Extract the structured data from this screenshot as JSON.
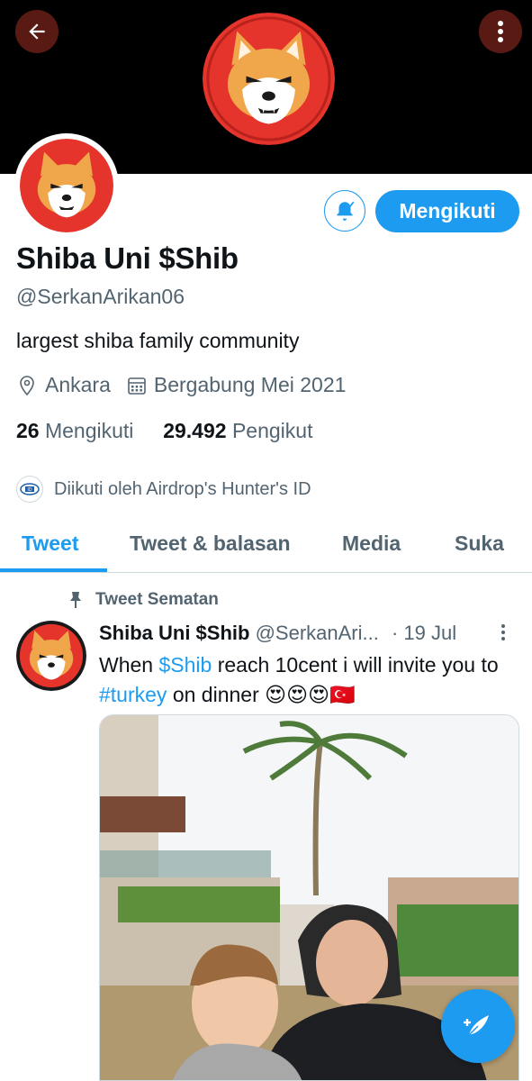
{
  "profile": {
    "name": "Shiba Uni $Shib",
    "handle": "@SerkanArikan06",
    "bio": "largest shiba family community",
    "location": "Ankara",
    "joined": "Bergabung Mei 2021",
    "following_count": "26",
    "following_label": "Mengikuti",
    "followers_count": "29.492",
    "followers_label": "Pengikut",
    "followed_by": "Diikuti oleh Airdrop's Hunter's ID"
  },
  "actions": {
    "follow_label": "Mengikuti"
  },
  "tabs": [
    {
      "label": "Tweet"
    },
    {
      "label": "Tweet & balasan"
    },
    {
      "label": "Media"
    },
    {
      "label": "Suka"
    }
  ],
  "pinned_tweet": {
    "pinned_label": "Tweet Sematan",
    "author_name": "Shiba Uni $Shib",
    "author_handle": "@SerkanAri...",
    "time": "· 19 Jul",
    "text_part1": "When ",
    "hashtag1": "$Shib",
    "text_part2": " reach 10cent i will invite you to ",
    "hashtag2": "#turkey",
    "text_part3": " on dinner ",
    "emoji": "😍😍😍🇹🇷"
  },
  "colors": {
    "accent": "#1d9bf0",
    "banner": "#000000",
    "header_button": "#5a1a14",
    "secondary_text": "#536471"
  },
  "icons": {
    "back": "arrow-left-icon",
    "more": "more-vertical-icon",
    "bell": "bell-notify-icon",
    "location": "location-pin-icon",
    "calendar": "calendar-icon",
    "pin": "pin-icon",
    "compose": "compose-tweet-icon"
  }
}
